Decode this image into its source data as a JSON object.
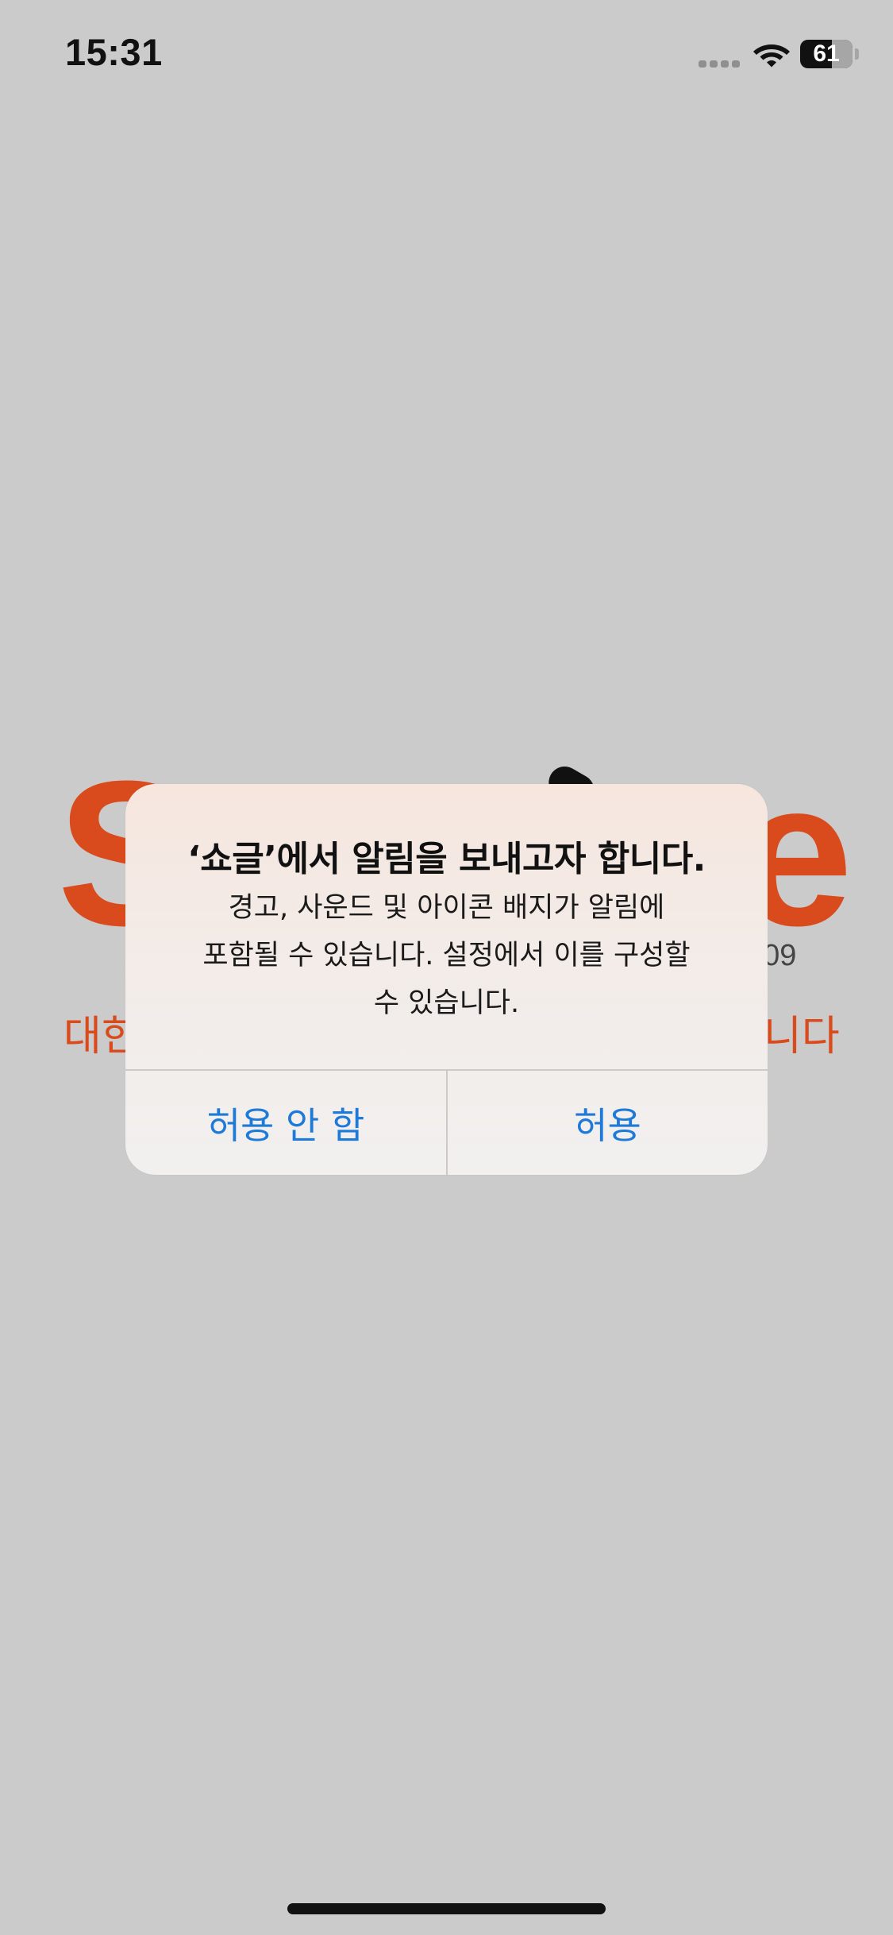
{
  "status_bar": {
    "time": "15:31",
    "battery_level": "61",
    "battery_fraction": 0.61,
    "icons": [
      "signal-icon",
      "wifi-icon",
      "battery-icon"
    ]
  },
  "splash": {
    "letter_left": "S",
    "letter_right": "e",
    "year_fragment": "009",
    "tagline_left": "대한",
    "tagline_right": "니다",
    "brand_color": "#d94a1c"
  },
  "alert": {
    "title": "‘쇼글’에서 알림을 보내고자 합니다.",
    "message_lines": [
      "경고, 사운드 및 아이콘 배지가 알림에",
      "포함될 수 있습니다. 설정에서 이를 구성할",
      "수 있습니다."
    ],
    "deny_label": "허용 안 함",
    "allow_label": "허용",
    "button_color": "#1e7ad8"
  },
  "background_color": "#cbcbcb"
}
